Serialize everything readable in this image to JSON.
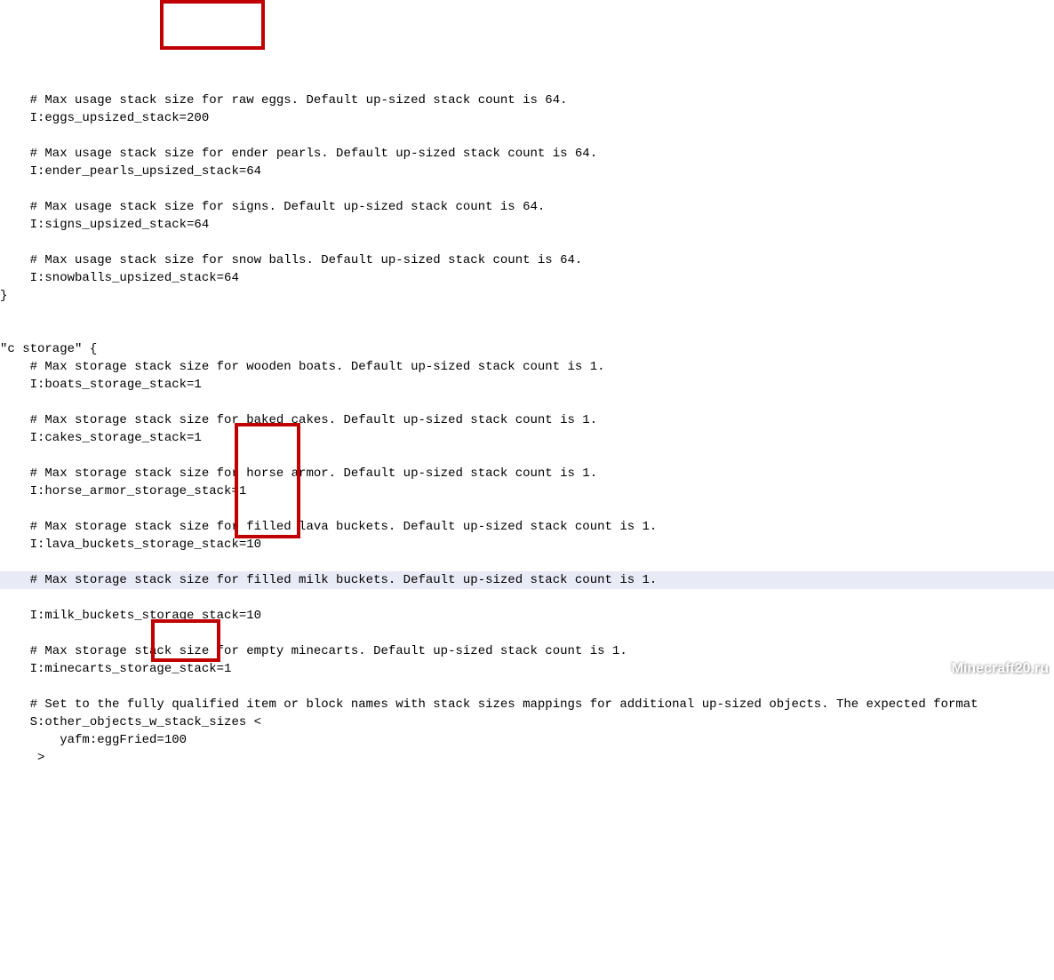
{
  "lines": {
    "l1": "    # Max usage stack size for raw eggs. Default up-sized stack count is 64.",
    "l2": "    I:eggs_upsized_stack=200",
    "l3": "",
    "l4": "    # Max usage stack size for ender pearls. Default up-sized stack count is 64.",
    "l5": "    I:ender_pearls_upsized_stack=64",
    "l6": "",
    "l7": "    # Max usage stack size for signs. Default up-sized stack count is 64.",
    "l8": "    I:signs_upsized_stack=64",
    "l9": "",
    "l10": "    # Max usage stack size for snow balls. Default up-sized stack count is 64.",
    "l11": "    I:snowballs_upsized_stack=64",
    "l12": "}",
    "l13": "",
    "l14": "",
    "l15": "\"c storage\" {",
    "l16": "    # Max storage stack size for wooden boats. Default up-sized stack count is 1.",
    "l17": "    I:boats_storage_stack=1",
    "l18": "",
    "l19": "    # Max storage stack size for baked cakes. Default up-sized stack count is 1.",
    "l20": "    I:cakes_storage_stack=1",
    "l21": "",
    "l22": "    # Max storage stack size for horse armor. Default up-sized stack count is 1.",
    "l23": "    I:horse_armor_storage_stack=1",
    "l24": "",
    "l25": "    # Max storage stack size for filled lava buckets. Default up-sized stack count is 1.",
    "l26": "    I:lava_buckets_storage_stack=10",
    "l27": "",
    "l28": "    # Max storage stack size for filled milk buckets. Default up-sized stack count is 1.",
    "l29": "    I:milk_buckets_storage_stack=10",
    "l30": "",
    "l31": "    # Max storage stack size for empty minecarts. Default up-sized stack count is 1.",
    "l32": "    I:minecarts_storage_stack=1",
    "l33": "",
    "l34": "    # Set to the fully qualified item or block names with stack sizes mappings for additional up-sized objects. The expected format",
    "l35": "    S:other_objects_w_stack_sizes <",
    "l36": "        yafm:eggFried=100",
    "l37": "     >"
  },
  "watermark": "Minecraft20.ru"
}
